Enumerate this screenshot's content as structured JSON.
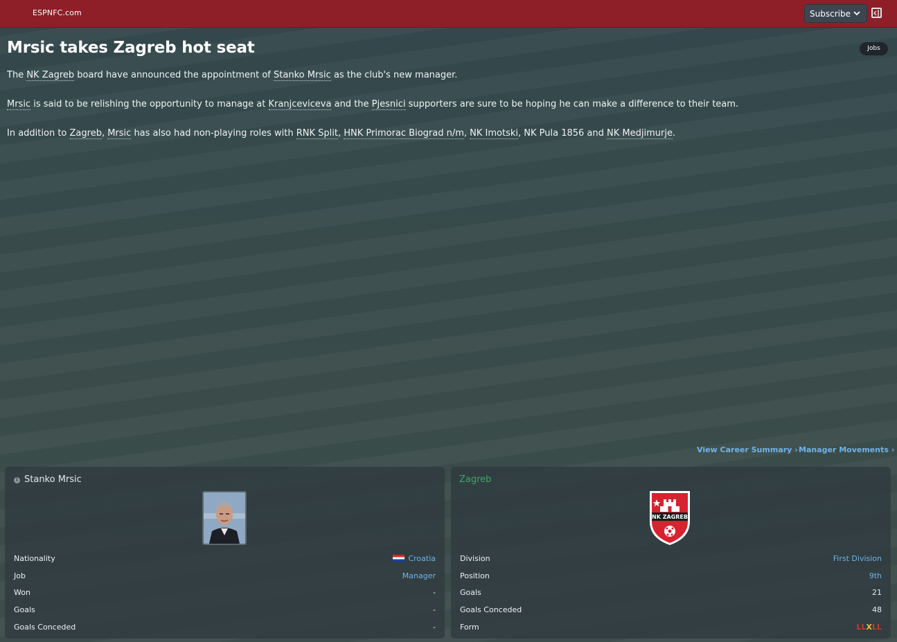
{
  "topbar": {
    "brand": "ESPNFC.com",
    "subscribe_label": "Subscribe",
    "color": "#8e1f28"
  },
  "article": {
    "headline": "Mrsic takes Zagreb hot seat",
    "tag": "Jobs",
    "p1": {
      "a": "The ",
      "club": "NK Zagreb",
      "b": " board have announced the appointment of ",
      "manager": "Stanko Mrsic",
      "c": " as the club's new manager."
    },
    "p2": {
      "manager": "Mrsic",
      "a": " is said to be relishing the opportunity to manage at ",
      "stadium": "Kranjceviceva",
      "b": " and the ",
      "fans": "Pjesnici",
      "c": " supporters are sure to be hoping he can make a difference to their team."
    },
    "p3": {
      "a": "In addition to ",
      "club": "Zagreb",
      "comma1": ", ",
      "manager": "Mrsic",
      "b": " has also had non-playing roles with ",
      "club1": "RNK Split",
      "s1": ", ",
      "club2": "HNK Primorac Biograd n/m",
      "s2": ", ",
      "club3": "NK Imotski",
      "c": ", NK Pula 1856 and ",
      "club4": "NK Medjimurje",
      "d": "."
    }
  },
  "links": {
    "career_summary": "View Career Summary",
    "manager_movements": "Manager Movements"
  },
  "manager_panel": {
    "name": "Stanko Mrsic",
    "rows": [
      {
        "label": "Nationality",
        "value": "Croatia"
      },
      {
        "label": "Job",
        "value": "Manager"
      },
      {
        "label": "Won",
        "value": "-"
      },
      {
        "label": "Goals",
        "value": "-"
      },
      {
        "label": "Goals Conceded",
        "value": "-"
      }
    ]
  },
  "club_panel": {
    "name": "Zagreb",
    "name_color": "#3fa66b",
    "crest_text": "NK ZAGREB",
    "rows": [
      {
        "label": "Division",
        "value": "First Division"
      },
      {
        "label": "Position",
        "value": "9th"
      },
      {
        "label": "Goals",
        "value": "21"
      },
      {
        "label": "Goals Conceded",
        "value": "48"
      },
      {
        "label": "Form",
        "value": ""
      }
    ],
    "form": [
      "L",
      "L",
      "X",
      "L",
      "L"
    ]
  },
  "colors": {
    "link": "#6fb4e8",
    "loss": "#d2392b",
    "draw": "#e8c62a"
  }
}
